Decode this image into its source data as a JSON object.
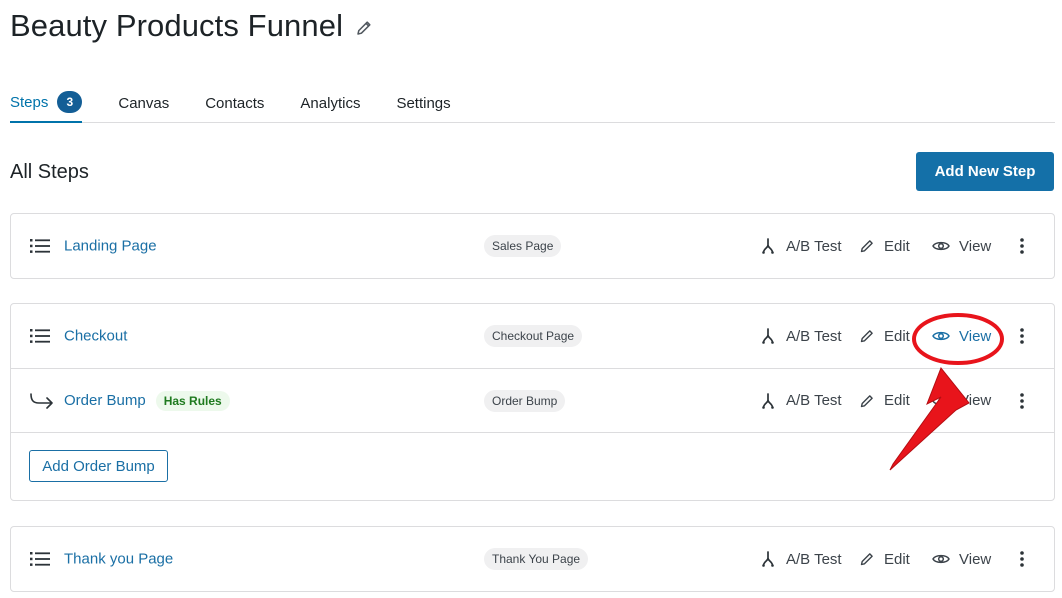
{
  "page": {
    "title": "Beauty Products Funnel"
  },
  "tabs": [
    {
      "label": "Steps",
      "badge": "3"
    },
    {
      "label": "Canvas"
    },
    {
      "label": "Contacts"
    },
    {
      "label": "Analytics"
    },
    {
      "label": "Settings"
    }
  ],
  "section": {
    "title": "All Steps",
    "add_button": "Add New Step"
  },
  "actions": {
    "ab_test": "A/B Test",
    "edit": "Edit",
    "view": "View"
  },
  "steps": [
    {
      "name": "Landing Page",
      "type": "Sales Page"
    },
    {
      "name": "Checkout",
      "type": "Checkout Page"
    },
    {
      "name": "Order Bump",
      "tag": "Has Rules",
      "type": "Order Bump"
    },
    {
      "name": "Thank you Page",
      "type": "Thank You Page"
    }
  ],
  "add_order_bump": "Add Order Bump",
  "icons": [
    "pencil-icon",
    "drag-handle-icon",
    "split-icon",
    "edit-icon",
    "eye-icon",
    "more-vertical-icon",
    "arrow-return-icon"
  ],
  "colors": {
    "accent": "#1470a8",
    "link": "#1a6fa5",
    "annotation": "#e8141b"
  }
}
